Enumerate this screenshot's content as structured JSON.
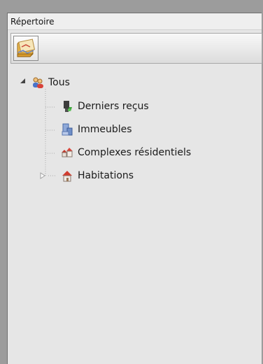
{
  "panel": {
    "title": "Répertoire"
  },
  "toolbar": {
    "buttons": [
      {
        "icon": "map-folder-icon"
      }
    ]
  },
  "tree": {
    "root": {
      "label": "Tous",
      "icon": "users-icon",
      "expanded": true,
      "children": [
        {
          "label": "Derniers reçus",
          "icon": "plant-pot-icon"
        },
        {
          "label": "Immeubles",
          "icon": "buildings-icon"
        },
        {
          "label": "Complexes résidentiels",
          "icon": "houses-icon"
        },
        {
          "label": "Habitations",
          "icon": "house-icon",
          "expanded": false
        }
      ]
    }
  },
  "colors": {
    "panel_bg": "#e6e6e6",
    "frame": "#9c9c9c"
  }
}
